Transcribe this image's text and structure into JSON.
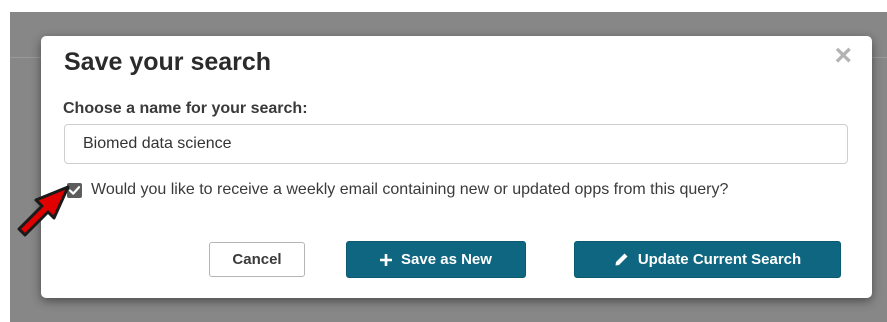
{
  "dialog": {
    "title": "Save your search",
    "close_glyph": "×",
    "name_label": "Choose a name for your search:",
    "name_value": "Biomed data science",
    "weekly_email_checked": true,
    "weekly_email_label": "Would you like to receive a weekly email containing new or updated opps from this query?",
    "buttons": {
      "cancel": "Cancel",
      "save_as_new": "Save as New",
      "update_current": "Update Current Search"
    }
  },
  "icons": {
    "close": "close-icon",
    "checkbox": "checkmark-icon",
    "save_as_new": "plus-icon",
    "update_current": "pencil-icon",
    "annotation": "red-arrow-icon"
  },
  "colors": {
    "primary_button": "#0f6680",
    "backdrop": "#878787",
    "checkbox": "#5d5d5d",
    "annotation_arrow": "#e00000"
  }
}
